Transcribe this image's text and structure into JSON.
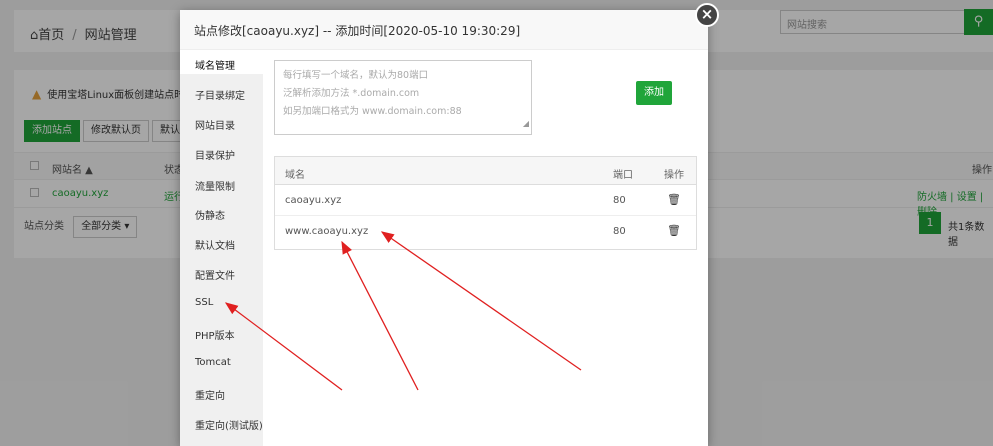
{
  "background": {
    "breadcrumb": {
      "home": "首页",
      "separator": "/",
      "current": "网站管理"
    },
    "search": {
      "placeholder": "网站搜索"
    },
    "warning": "使用宝塔Linux面板创建站点时会",
    "buttons": [
      "添加站点",
      "修改默认页",
      "默认站"
    ],
    "table": {
      "headers": {
        "name": "网站名 ▲",
        "status": "状态",
        "ops": "操作"
      },
      "row": {
        "name": "caoayu.xyz",
        "status": "运行",
        "ops": "防火墙 | 设置 | 删除"
      }
    },
    "category_label": "站点分类",
    "category_select": "全部分类",
    "pagination": {
      "page": "1",
      "summary": "共1条数据"
    }
  },
  "modal": {
    "title": "站点修改[caoayu.xyz] -- 添加时间[2020-05-10 19:30:29]",
    "close": "×",
    "sidebar": [
      "域名管理",
      "子目录绑定",
      "网站目录",
      "目录保护",
      "流量限制",
      "伪静态",
      "默认文档",
      "配置文件",
      "SSL",
      "PHP版本",
      "Tomcat",
      "重定向",
      "重定向(测试版)"
    ],
    "textarea_lines": [
      "每行填写一个域名，默认为80端口",
      "泛解析添加方法 *.domain.com",
      "如另加端口格式为 www.domain.com:88"
    ],
    "add_button": "添加",
    "domain_table": {
      "headers": {
        "domain": "域名",
        "port": "端口",
        "action": "操作"
      },
      "rows": [
        {
          "domain": "caoayu.xyz",
          "port": "80"
        },
        {
          "domain": "www.caoayu.xyz",
          "port": "80"
        }
      ]
    }
  },
  "colors": {
    "accent": "#20a53a",
    "annotation_arrows": "#e02020"
  }
}
